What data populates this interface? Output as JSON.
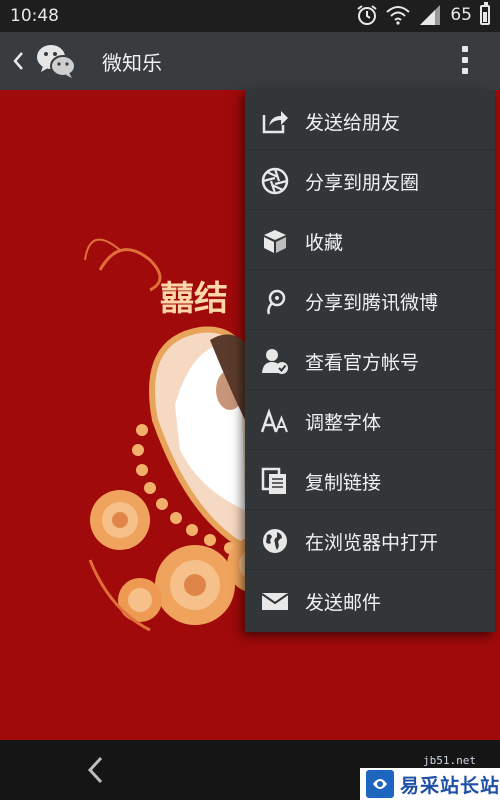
{
  "status_bar": {
    "time": "10:48",
    "battery_level": "65"
  },
  "title_bar": {
    "title": "微知乐",
    "back_icon": "back-chevron-icon",
    "logo_icon": "wechat-logo-icon",
    "more_icon": "overflow-menu-icon"
  },
  "popup_menu": {
    "items": [
      {
        "label": "发送给朋友",
        "icon": "share-forward-icon"
      },
      {
        "label": "分享到朋友圈",
        "icon": "moments-aperture-icon"
      },
      {
        "label": "收藏",
        "icon": "favorite-box-icon"
      },
      {
        "label": "分享到腾讯微博",
        "icon": "tencent-weibo-icon"
      },
      {
        "label": "查看官方帐号",
        "icon": "official-account-icon"
      },
      {
        "label": "调整字体",
        "icon": "font-size-icon"
      },
      {
        "label": "复制链接",
        "icon": "copy-link-icon"
      },
      {
        "label": "在浏览器中打开",
        "icon": "globe-icon"
      },
      {
        "label": "发送邮件",
        "icon": "mail-icon"
      }
    ]
  },
  "content": {
    "card_title": "囍结"
  },
  "watermark": {
    "small_text": "jb51.net",
    "brand": "易采站长站"
  },
  "colors": {
    "status_bar": "#1e1e1e",
    "title_bar": "#383c3e",
    "menu_bg": "#323638",
    "content_bg": "#a00a0a",
    "watermark_blue": "#1d4fa6"
  }
}
